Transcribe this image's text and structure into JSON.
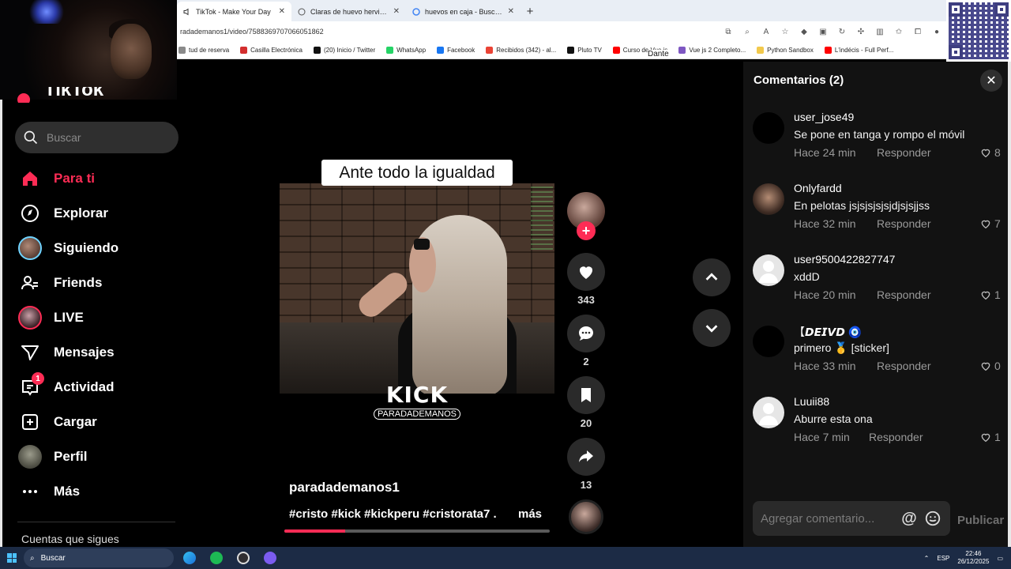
{
  "browser": {
    "tabs": [
      {
        "title": "TikTok - Make Your Day",
        "active": true
      },
      {
        "title": "Claras de huevo hervidas",
        "active": false
      },
      {
        "title": "huevos en caja - Buscar con Goog",
        "active": false
      }
    ],
    "url": "radademanos1/video/7588369707066051862",
    "bookmarks": [
      {
        "label": "tud de reserva",
        "color": "#8a8a8a"
      },
      {
        "label": "Casilla Electrónica",
        "color": "#d32f2f"
      },
      {
        "label": "(20) Inicio / Twitter",
        "color": "#111111"
      },
      {
        "label": "WhatsApp",
        "color": "#25d366"
      },
      {
        "label": "Facebook",
        "color": "#1877f2"
      },
      {
        "label": "Recibidos (342) - al...",
        "color": "#ea4335"
      },
      {
        "label": "Pluto TV",
        "color": "#111111"
      },
      {
        "label": "Curso de Vue.js",
        "color": "#ff0000"
      },
      {
        "label": "Vue js 2 Completo...",
        "color": "#7e57c2"
      },
      {
        "label": "Python Sandbox",
        "color": "#f2c94c"
      },
      {
        "label": "L'indécis - Full Perf...",
        "color": "#ff0000"
      }
    ],
    "overlay_label": "Dante"
  },
  "sidebar": {
    "logo_text": "TikTok",
    "search_placeholder": "Buscar",
    "items": [
      {
        "label": "Para ti",
        "icon": "home-icon"
      },
      {
        "label": "Explorar",
        "icon": "compass-icon"
      },
      {
        "label": "Siguiendo",
        "icon": "avatar"
      },
      {
        "label": "Friends",
        "icon": "friends-icon"
      },
      {
        "label": "LIVE",
        "icon": "avatar"
      },
      {
        "label": "Mensajes",
        "icon": "send-icon"
      },
      {
        "label": "Actividad",
        "icon": "inbox-icon"
      },
      {
        "label": "Cargar",
        "icon": "plus-box-icon"
      },
      {
        "label": "Perfil",
        "icon": "avatar"
      },
      {
        "label": "Más",
        "icon": "more-icon"
      }
    ],
    "activity_badge": "1",
    "following_label": "Cuentas que sigues"
  },
  "video": {
    "caption_overlay": "Ante todo la igualdad",
    "watermark": "KICK",
    "watermark_handle": "PARADADEMANOS",
    "username": "paradademanos1",
    "hashtags": "#cristo #kick #kickperu #cristorata7 ...",
    "more_label": "más",
    "progress": 0.23
  },
  "actions": {
    "likes": "343",
    "comments": "2",
    "saves": "20",
    "shares": "13"
  },
  "comments_panel": {
    "title": "Comentarios (2)",
    "reply_label": "Responder",
    "items": [
      {
        "user": "user_jose49",
        "text": "Se pone en tanga y rompo el móvil",
        "time": "Hace 24 min",
        "likes": "8",
        "avatar": "black"
      },
      {
        "user": "Onlyfardd",
        "text": "En pelotas jsjsjsjsjsjdjsjsjjss",
        "time": "Hace 32 min",
        "likes": "7",
        "avatar": "pic"
      },
      {
        "user": "user9500422827747",
        "text": "xddD",
        "time": "Hace 20 min",
        "likes": "1",
        "avatar": "grey"
      },
      {
        "user": "【𝘿𝙀𝙄𝙑𝘿 🧿",
        "text": "primero 🥇 [sticker]",
        "time": "Hace 33 min",
        "likes": "0",
        "avatar": "black"
      },
      {
        "user": "Luuii88",
        "text": "Aburre esta ona",
        "time": "Hace 7 min",
        "likes": "1",
        "avatar": "grey"
      }
    ],
    "input_placeholder": "Agregar comentario...",
    "publish_label": "Publicar"
  },
  "taskbar": {
    "search_placeholder": "Buscar",
    "language": "ESP",
    "time": "22:46",
    "date": "26/12/2025"
  }
}
